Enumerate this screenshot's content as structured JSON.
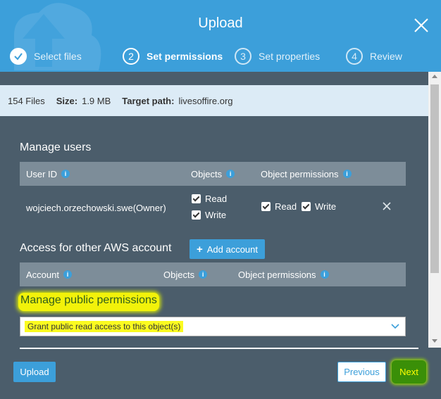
{
  "header": {
    "title": "Upload",
    "steps": [
      {
        "num": "✓",
        "label": "Select files",
        "state": "done"
      },
      {
        "num": "2",
        "label": "Set permissions",
        "state": "active"
      },
      {
        "num": "3",
        "label": "Set properties",
        "state": "pending"
      },
      {
        "num": "4",
        "label": "Review",
        "state": "pending"
      }
    ]
  },
  "summary": {
    "files": "154 Files",
    "size_label": "Size:",
    "size_value": "1.9 MB",
    "target_label": "Target path:",
    "target_value": "livesoffire.org"
  },
  "manage_users": {
    "title": "Manage users",
    "columns": [
      "User ID",
      "Objects",
      "Object permissions"
    ],
    "row": {
      "user": "wojciech.orzechowski.swe(Owner)",
      "objects": [
        {
          "label": "Read",
          "checked": true
        },
        {
          "label": "Write",
          "checked": true
        }
      ],
      "object_permissions": [
        {
          "label": "Read",
          "checked": true
        },
        {
          "label": "Write",
          "checked": true
        }
      ]
    }
  },
  "other_account": {
    "title": "Access for other AWS account",
    "add_button": "Add account",
    "columns": [
      "Account",
      "Objects",
      "Object permissions"
    ]
  },
  "public": {
    "title": "Manage public permissions",
    "selected": "Grant public read access to this object(s)"
  },
  "footer": {
    "upload": "Upload",
    "previous": "Previous",
    "next": "Next"
  },
  "colors": {
    "header": "#3c9fda",
    "body": "#4b5d6b",
    "table_head": "#7d8d99",
    "highlight": "#f2f20a",
    "next": "#3a8f08"
  }
}
